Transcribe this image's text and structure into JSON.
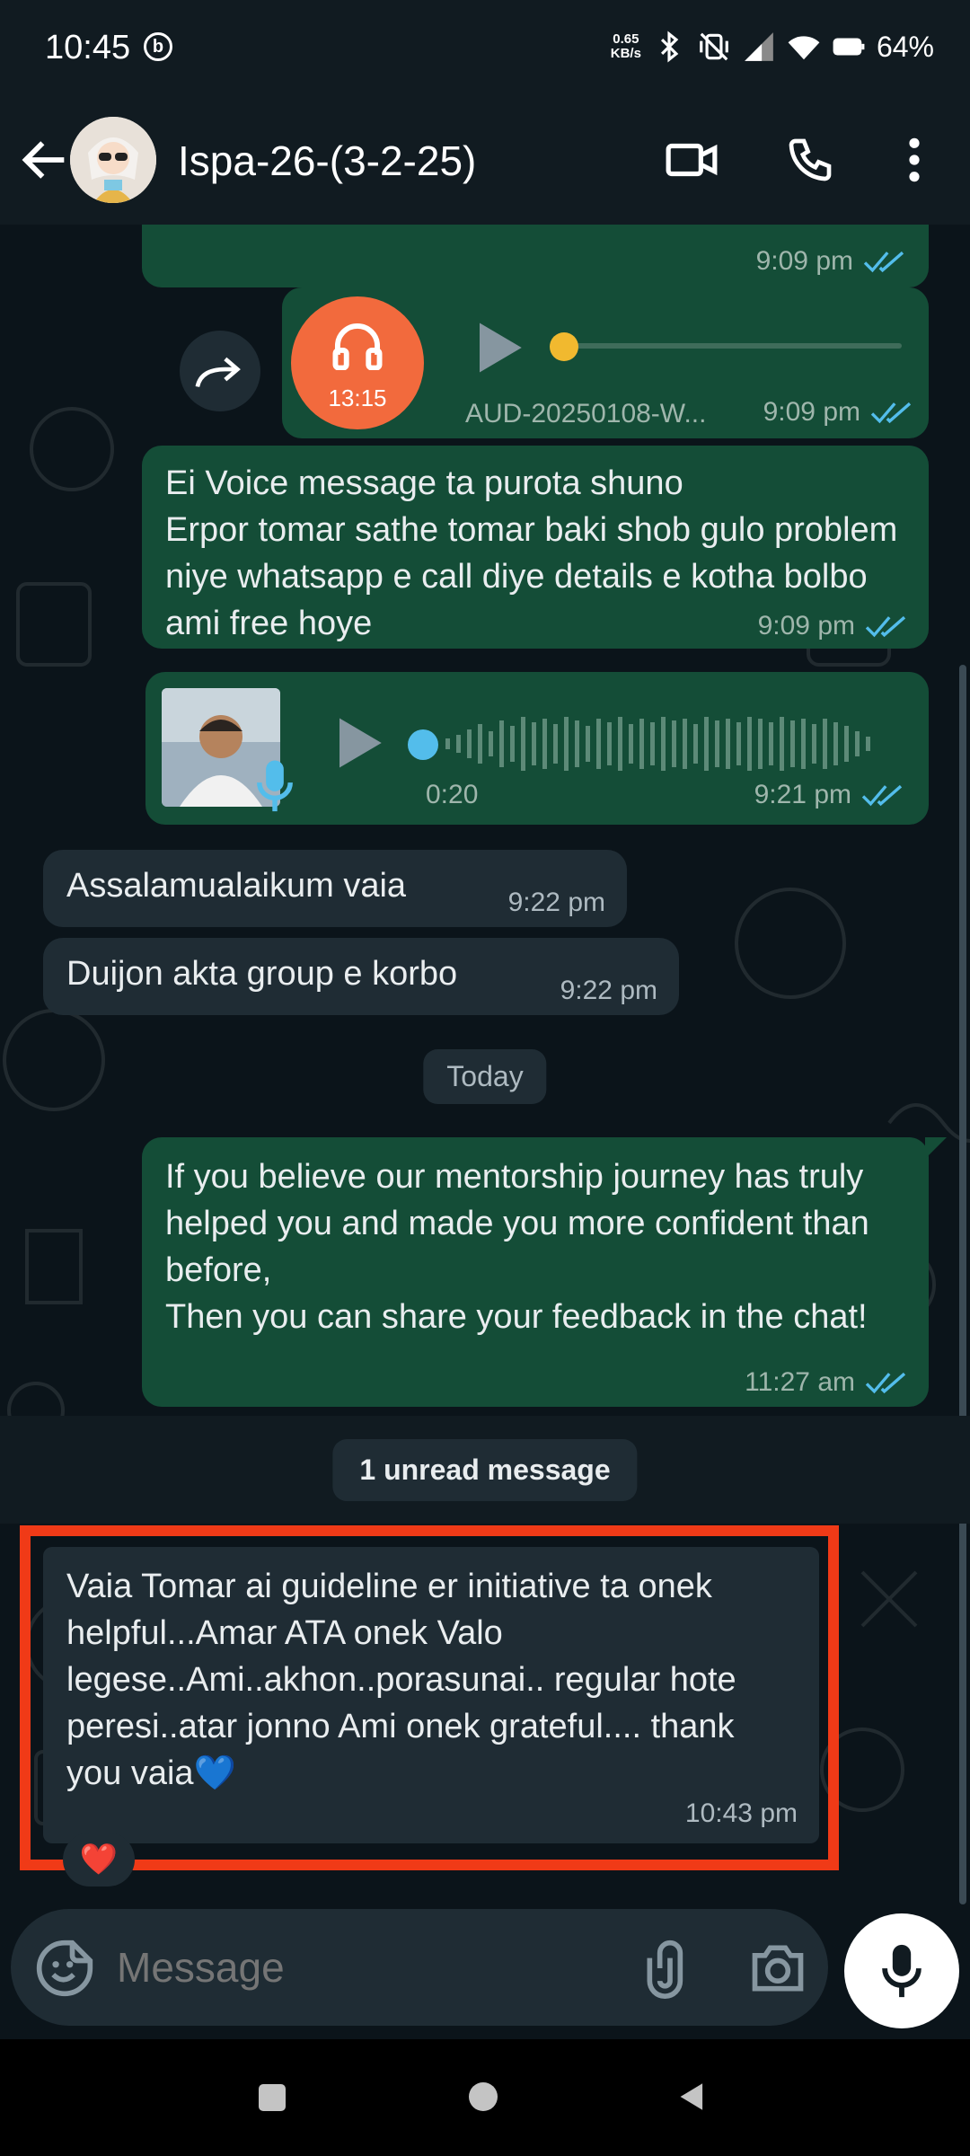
{
  "status_bar": {
    "time": "10:45",
    "network_speed_value": "0.65",
    "network_speed_unit": "KB/s",
    "battery": "64%"
  },
  "header": {
    "contact_name": "Ispa-26-(3-2-25)"
  },
  "messages": [
    {
      "type": "outgoing-text",
      "time": "9:09 pm",
      "status": "read"
    },
    {
      "type": "outgoing-audio-file",
      "duration": "13:15",
      "filename": "AUD-20250108-W...",
      "time": "9:09 pm",
      "status": "read"
    },
    {
      "type": "outgoing-text",
      "text": "Ei Voice message ta purota shuno\nErpor tomar sathe tomar baki shob gulo problem niye whatsapp e call diye details e kotha bolbo ami free hoye",
      "time": "9:09 pm",
      "status": "read"
    },
    {
      "type": "outgoing-voice-note",
      "duration": "0:20",
      "time": "9:21 pm",
      "status": "read"
    },
    {
      "type": "incoming-text",
      "text": "Assalamualaikum vaia",
      "time": "9:22 pm"
    },
    {
      "type": "incoming-text",
      "text": "Duijon akta group e korbo",
      "time": "9:22 pm"
    },
    {
      "type": "date-divider",
      "text": "Today"
    },
    {
      "type": "outgoing-text",
      "text": "If you believe our mentorship journey has truly helped you and made you more confident than before,\nThen you can share your feedback in the chat!",
      "time": "11:27 am",
      "status": "read"
    },
    {
      "type": "unread-divider",
      "text": "1 unread message"
    },
    {
      "type": "incoming-text",
      "text": "Vaia Tomar ai guideline er initiative ta onek helpful...Amar ATA onek Valo legese..Ami..akhon..porasunai.. regular hote peresi..atar jonno Ami onek grateful.... thank you vaia💙",
      "time": "10:43 pm",
      "reaction": "❤️",
      "highlighted": true
    }
  ],
  "composer": {
    "placeholder": "Message"
  },
  "colors": {
    "outgoing_bubble": "#144d37",
    "incoming_bubble": "#1f2c34",
    "read_ticks": "#53bdeb",
    "highlight_box": "#f03a17",
    "audio_badge": "#f26a3d"
  }
}
